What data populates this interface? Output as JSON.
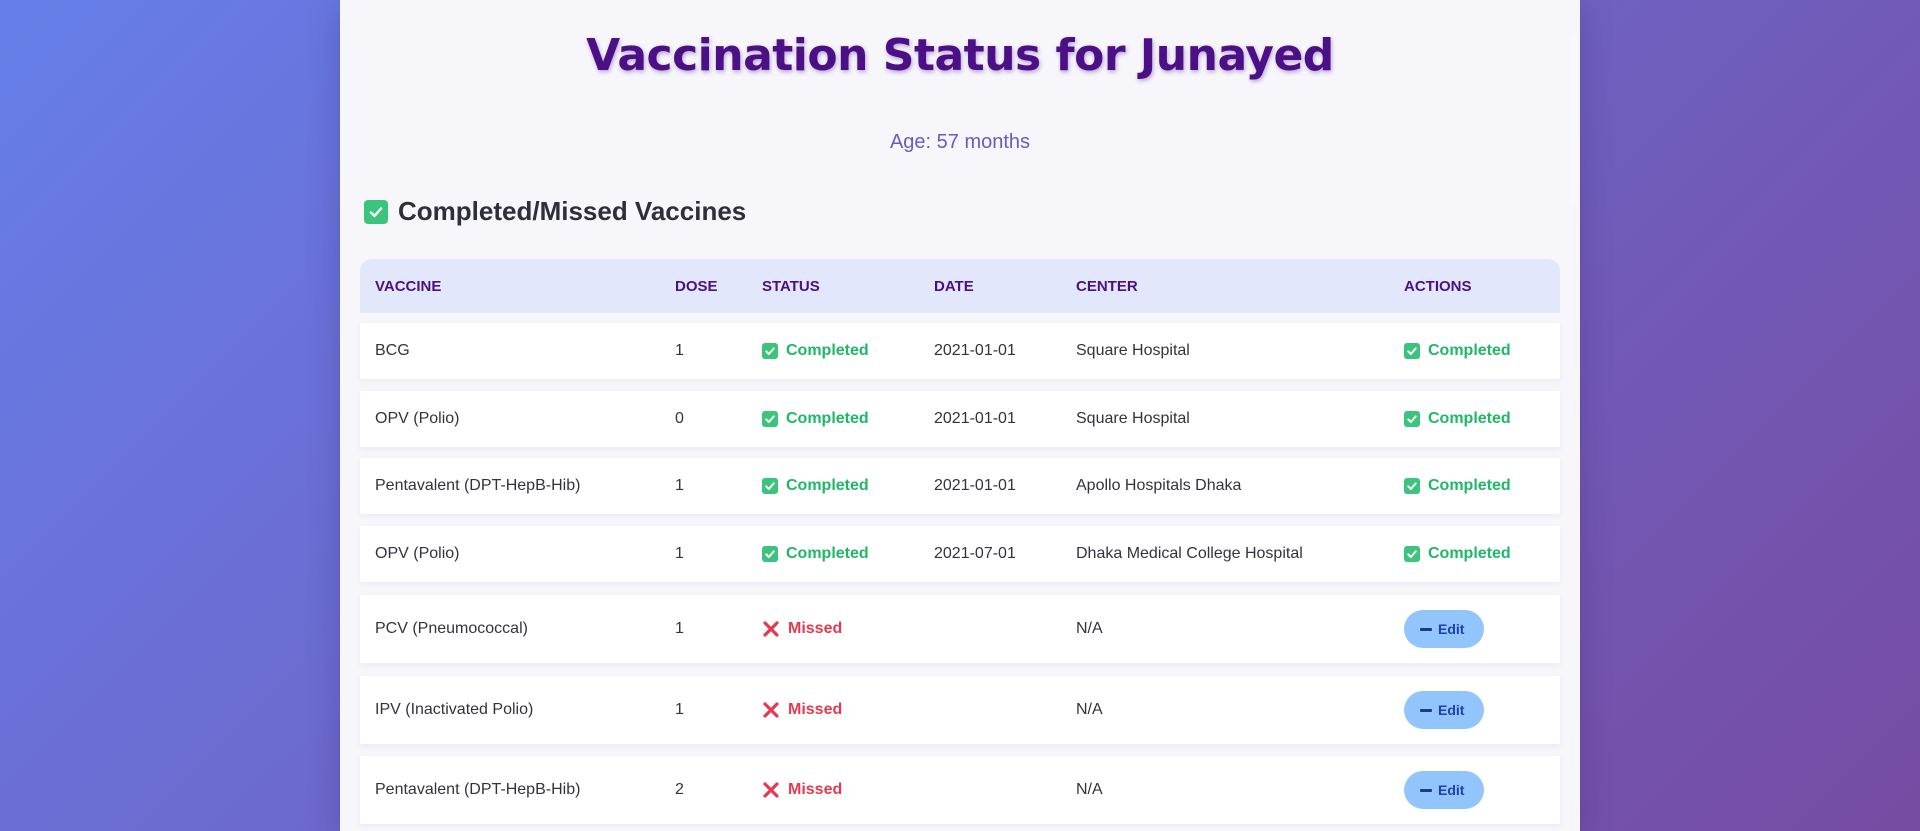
{
  "page": {
    "title": "Vaccination Status for Junayed",
    "age": "Age: 57 months"
  },
  "section": {
    "heading": "Completed/Missed Vaccines",
    "icon": "checkbox-icon"
  },
  "table": {
    "headers": [
      "VACCINE",
      "DOSE",
      "STATUS",
      "DATE",
      "CENTER",
      "ACTIONS"
    ],
    "rows": [
      {
        "vaccine": "BCG",
        "dose": "1",
        "status": "Completed",
        "date": "2021-01-01",
        "center": "Square Hospital",
        "action": "Completed"
      },
      {
        "vaccine": "OPV (Polio)",
        "dose": "0",
        "status": "Completed",
        "date": "2021-01-01",
        "center": "Square Hospital",
        "action": "Completed"
      },
      {
        "vaccine": "Pentavalent (DPT-HepB-Hib)",
        "dose": "1",
        "status": "Completed",
        "date": "2021-01-01",
        "center": "Apollo Hospitals Dhaka",
        "action": "Completed"
      },
      {
        "vaccine": "OPV (Polio)",
        "dose": "1",
        "status": "Completed",
        "date": "2021-07-01",
        "center": "Dhaka Medical College Hospital",
        "action": "Completed"
      },
      {
        "vaccine": "PCV (Pneumococcal)",
        "dose": "1",
        "status": "Missed",
        "date": "",
        "center": "N/A",
        "action": "Edit"
      },
      {
        "vaccine": "IPV (Inactivated Polio)",
        "dose": "1",
        "status": "Missed",
        "date": "",
        "center": "N/A",
        "action": "Edit"
      },
      {
        "vaccine": "Pentavalent (DPT-HepB-Hib)",
        "dose": "2",
        "status": "Missed",
        "date": "",
        "center": "N/A",
        "action": "Edit"
      }
    ]
  },
  "colors": {
    "completed": "#1fb866",
    "missed": "#e53950",
    "edit_button": "#93c5fd",
    "title": "#4b0f86"
  }
}
